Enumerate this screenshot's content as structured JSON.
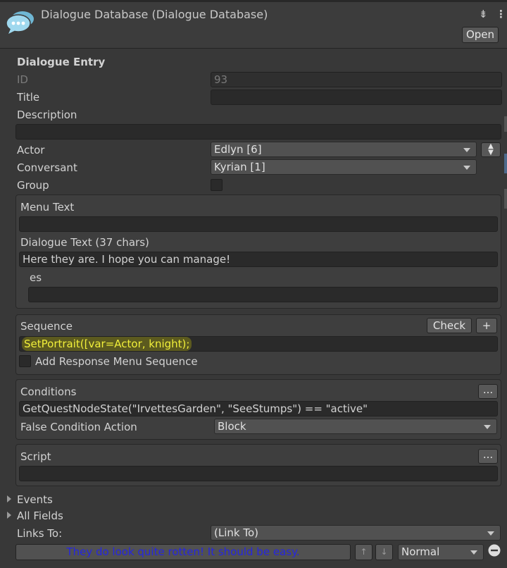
{
  "header": {
    "title": "Dialogue Database (Dialogue Database)",
    "open_label": "Open",
    "pin_icon": "pin-icon",
    "menu_icon": "kebab-menu-icon"
  },
  "entry": {
    "section_title": "Dialogue Entry",
    "id_label": "ID",
    "id_value": "93",
    "title_label": "Title",
    "title_value": "",
    "description_label": "Description",
    "description_value": "",
    "actor_label": "Actor",
    "actor_value": "Edlyn [6]",
    "conversant_label": "Conversant",
    "conversant_value": "Kyrian [1]",
    "group_label": "Group",
    "group_checked": false
  },
  "text_box": {
    "menu_text_label": "Menu Text",
    "menu_text_value": "",
    "dialogue_text_label": "Dialogue Text (37 chars)",
    "dialogue_text_value": "Here they are. I hope you can manage!",
    "locale_label": "es",
    "locale_value": ""
  },
  "sequence_box": {
    "label": "Sequence",
    "check_label": "Check",
    "plus_label": "+",
    "value": "SetPortrait([var=Actor, knight);",
    "add_response_label": "Add Response Menu Sequence",
    "add_response_checked": false
  },
  "conditions_box": {
    "label": "Conditions",
    "more_label": "...",
    "value": "GetQuestNodeState(\"IrvettesGarden\", \"SeeStumps\")  == \"active\"",
    "false_action_label": "False Condition Action",
    "false_action_value": "Block"
  },
  "script_box": {
    "label": "Script",
    "more_label": "...",
    "value": ""
  },
  "events_label": "Events",
  "all_fields_label": "All Fields",
  "links": {
    "label": "Links To:",
    "dropdown_value": "(Link To)",
    "link_text": "They do look quite rotten! It should be easy.",
    "priority_value": "Normal",
    "up_icon": "arrow-up-icon",
    "down_icon": "arrow-down-icon",
    "remove_icon": "minus-circle-icon"
  },
  "colors": {
    "background": "#383838",
    "field": "#2a2a2a",
    "sequence_highlight": "#f1ef3a",
    "link_text": "#2626e0"
  }
}
